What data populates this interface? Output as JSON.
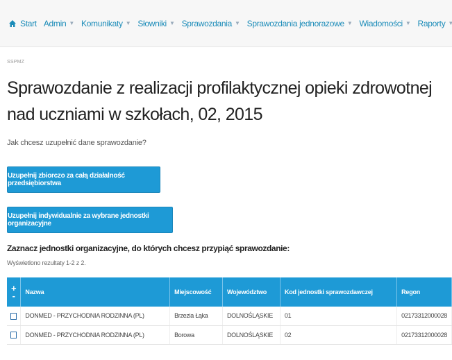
{
  "nav": {
    "home": "Start",
    "items": [
      {
        "label": "Admin",
        "caret": "▼"
      },
      {
        "label": "Komunikaty",
        "caret": "▼"
      },
      {
        "label": "Słowniki",
        "caret": "▼"
      },
      {
        "label": "Sprawozdania",
        "caret": "▼"
      },
      {
        "label": "Sprawozdania jednorazowe",
        "caret": "▼"
      },
      {
        "label": "Wiadomości",
        "caret": "▼"
      },
      {
        "label": "Raporty",
        "caret": "▼"
      }
    ]
  },
  "breadcrumb": "SSPMZ",
  "page": {
    "title": "Sprawozdanie z realizacji profilaktycznej opieki zdrowotnej nad uczniami w szkołach, 02, 2015",
    "question": "Jak chcesz uzupełnić dane sprawozdanie?",
    "button_collective": "Uzupełnij zbiorczo za całą działalność przedsiębiorstwa",
    "button_individual": "Uzupełnij indywidualnie za wybrane jednostki organizacyjne",
    "select_label": "Zaznacz jednostki organizacyjne, do których chcesz przypiąć sprawozdanie:",
    "results_count": "Wyświetlono rezultaty 1-2 z 2."
  },
  "table": {
    "select_toggle": {
      "plus": "+",
      "minus": "-"
    },
    "headers": [
      "Nazwa",
      "Miejscowość",
      "Województwo",
      "Kod jednostki sprawozdawczej",
      "Regon"
    ],
    "rows": [
      {
        "nazwa": "DONMED - PRZYCHODNIA RODZINNA (PL)",
        "miejscowosc": "Brzezia Łąka",
        "wojewodztwo": "DOLNOŚLĄSKIE",
        "kod": "01",
        "regon": "02173312000028"
      },
      {
        "nazwa": "DONMED - PRZYCHODNIA RODZINNA (PL)",
        "miejscowosc": "Borowa",
        "wojewodztwo": "DOLNOŚLĄSKIE",
        "kod": "02",
        "regon": "02173312000028"
      }
    ]
  },
  "colors": {
    "accent": "#1e9ad6",
    "link": "#1a8bb8"
  }
}
